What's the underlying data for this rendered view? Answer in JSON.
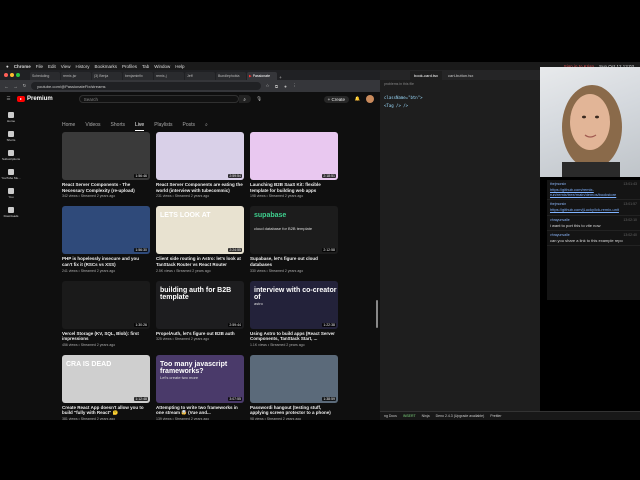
{
  "menubar": {
    "app": "Chrome",
    "items": [
      "File",
      "Edit",
      "View",
      "History",
      "Bookmarks",
      "Profiles",
      "Tab",
      "Window",
      "Help"
    ],
    "right_text": "Sign in to Krisp",
    "clock": "Sun Oct 12 13:03"
  },
  "browser": {
    "tabs": [
      "Scheduling",
      "remix-jsr",
      "(3) Benja",
      "benjaminfix",
      "remix-j",
      "Jeff",
      "Bundlephobia",
      "Passionate"
    ],
    "url": "youtube.com/@PassionateFix/streams"
  },
  "youtube": {
    "brand": "Premium",
    "search_placeholder": "Search",
    "create_label": "Create",
    "sidebar": [
      "Home",
      "Shorts",
      "Subscriptions",
      "YouTube Mu...",
      "You",
      "Downloads"
    ],
    "channel_tabs": [
      "Home",
      "Videos",
      "Shorts",
      "Live",
      "Playlists",
      "Posts"
    ],
    "active_tab": "Live",
    "videos": [
      {
        "title": "React Server Components - The Necessary Complexity (re-upload)",
        "meta": "342 views • Streamed 2 years ago",
        "duration": "1:56:46",
        "thumb_color": "#3a3a3a"
      },
      {
        "title": "React Server Components are eating the world (interview with tubecommic)",
        "meta": "231 views • Streamed 2 years ago",
        "duration": "2:59:54",
        "thumb_color": "#d9d0e8"
      },
      {
        "title": "Launching B2B SaaS Kit: flexible template for building web apps",
        "meta": "198 views • Streamed 2 years ago",
        "duration": "2:18:51",
        "thumb_color": "#e9c8f0"
      },
      {
        "title": "PHP is hopelessly insecure and you can't fix it (RSCs vs XSS)",
        "meta": "241 views • Streamed 2 years ago",
        "duration": "1:56:30",
        "thumb_color": "#2f4a7a"
      },
      {
        "title": "Client side routing in Astro: let's look at TanStack Router vs React Router",
        "meta": "2.5K views • Streamed 2 years ago",
        "duration": "2:24:55",
        "thumb_color": "#e8e2d0",
        "banner": "LETS LOOK AT"
      },
      {
        "title": "Supabase, let's figure out cloud databases",
        "meta": "330 views • Streamed 2 years ago",
        "duration": "2:12:58",
        "thumb_color": "#1c1c1c",
        "banner": "supabase",
        "sub": "cloud database for B2B template"
      },
      {
        "title": "Vercel Storage (KV, SQL, Blob): first impressions",
        "meta": "456 views • Streamed 2 years ago",
        "duration": "1:30:26",
        "thumb_color": "#1a1a1a"
      },
      {
        "title": "PropelAuth, let's figure out B2B auth",
        "meta": "325 views • Streamed 2 years ago",
        "duration": "2:59:44",
        "thumb_color": "#1d1d1f",
        "banner": "building auth for B2B template"
      },
      {
        "title": "Using Astro to build apps (React Server Components, TanStack Start, ...",
        "meta": "1.1K views • Streamed 2 years ago",
        "duration": "1:22:38",
        "thumb_color": "#23223a",
        "banner": "interview with co-creator of",
        "sub": "astro"
      },
      {
        "title": "Create React App doesn't allow you to build \"fully with React\" 🤔",
        "meta": "381 views • Streamed 2 years ago",
        "duration": "1:12:48",
        "thumb_color": "#cfcfcf",
        "banner": "CRA IS DEAD"
      },
      {
        "title": "Attempting to write two frameworks in one stream 🤯 (Vue and...",
        "meta": "139 views • Streamed 2 years ago",
        "duration": "3:07:55",
        "thumb_color": "#4a3a6a",
        "banner": "Too many javascript frameworks?",
        "sub": "Let's create two more"
      },
      {
        "title": "Passwordi hangout (testing stuff, applying screen protector to a phone)",
        "meta": "98 views • Streamed 2 years ago",
        "duration": "1:38:59",
        "thumb_color": "#5b6a7a"
      }
    ]
  },
  "editor": {
    "tabs": [
      "book-card.tsx",
      "cart-button.tsx"
    ],
    "active_tab": "book-card.tsx",
    "header": "problems in this file",
    "code_lines": [
      "className=\"btn\">",
      "",
      "",
      "<Tag /> />"
    ],
    "status_items": [
      "ng Docs",
      "INSERT",
      "Ninja",
      "Deno 2.4.3 (Upgrade available)",
      "Prettier"
    ]
  },
  "chat": {
    "messages": [
      {
        "user": "thejmorsin",
        "time": "13:01:43",
        "text": "https://github.com/remix-run/remix/tree/main/demos/bookstore",
        "link": true
      },
      {
        "user": "thejmorsin",
        "time": "13:01:57",
        "text": "https://github.com/jLucky/lck-remix-unit",
        "link": true
      },
      {
        "user": "vhrayunvalle",
        "time": "13:02:10",
        "text": "i want to port this to vite now",
        "link": false
      },
      {
        "user": "vhrayunvalle",
        "time": "13:02:40",
        "text": "can you share a link to this example repo",
        "link": false
      }
    ]
  },
  "colors": {
    "yt_bg": "#0f0f0f",
    "accent": "#ff0000",
    "chat_user": "#8ab4f8"
  }
}
